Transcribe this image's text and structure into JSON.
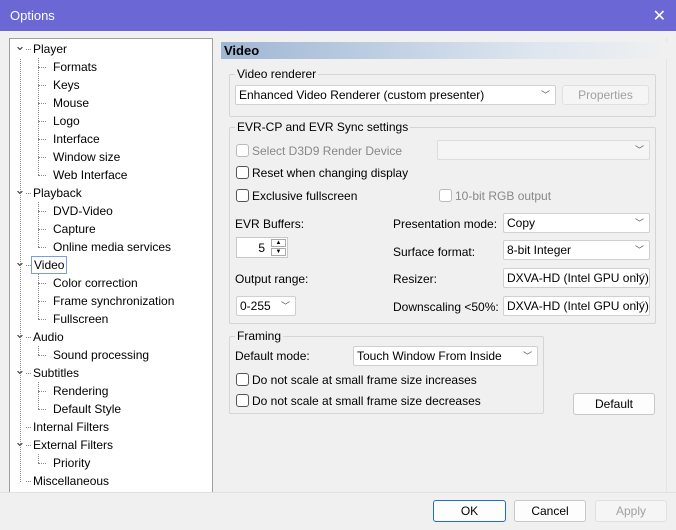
{
  "window": {
    "title": "Options",
    "close_icon": "close-icon",
    "title_color": "#6b68d5"
  },
  "tree": [
    {
      "label": "Player",
      "level": 0,
      "expanded": true
    },
    {
      "label": "Formats",
      "level": 1
    },
    {
      "label": "Keys",
      "level": 1
    },
    {
      "label": "Mouse",
      "level": 1
    },
    {
      "label": "Logo",
      "level": 1
    },
    {
      "label": "Interface",
      "level": 1
    },
    {
      "label": "Window size",
      "level": 1
    },
    {
      "label": "Web Interface",
      "level": 1
    },
    {
      "label": "Playback",
      "level": 0,
      "expanded": true
    },
    {
      "label": "DVD-Video",
      "level": 1
    },
    {
      "label": "Capture",
      "level": 1
    },
    {
      "label": "Online media services",
      "level": 1
    },
    {
      "label": "Video",
      "level": 0,
      "expanded": true,
      "selected": true
    },
    {
      "label": "Color correction",
      "level": 1
    },
    {
      "label": "Frame synchronization",
      "level": 1
    },
    {
      "label": "Fullscreen",
      "level": 1
    },
    {
      "label": "Audio",
      "level": 0,
      "expanded": true
    },
    {
      "label": "Sound processing",
      "level": 1
    },
    {
      "label": "Subtitles",
      "level": 0,
      "expanded": true
    },
    {
      "label": "Rendering",
      "level": 1
    },
    {
      "label": "Default Style",
      "level": 1
    },
    {
      "label": "Internal Filters",
      "level": 0
    },
    {
      "label": "External Filters",
      "level": 0,
      "expanded": true
    },
    {
      "label": "Priority",
      "level": 1
    },
    {
      "label": "Miscellaneous",
      "level": 0
    }
  ],
  "page": {
    "header": "Video",
    "renderer": {
      "group": "Video renderer",
      "value": "Enhanced Video Renderer (custom presenter)",
      "properties": "Properties"
    },
    "evr": {
      "group": "EVR-CP and EVR Sync settings",
      "select_d3d9": "Select D3D9 Render Device",
      "d3d9_value": "",
      "reset": "Reset when changing display",
      "exclusive": "Exclusive fullscreen",
      "rgb10": "10-bit RGB output",
      "buffers_label": "EVR Buffers:",
      "buffers_value": "5",
      "output_range_label": "Output range:",
      "output_range_value": "0-255",
      "presentation_label": "Presentation mode:",
      "presentation_value": "Copy",
      "surface_label": "Surface format:",
      "surface_value": "8-bit Integer",
      "resizer_label": "Resizer:",
      "resizer_value": "DXVA-HD (Intel GPU only)",
      "downscaling_label": "Downscaling <50%:",
      "downscaling_value": "DXVA-HD (Intel GPU only)"
    },
    "framing": {
      "group": "Framing",
      "default_mode_label": "Default mode:",
      "default_mode_value": "Touch Window From Inside",
      "no_scale_inc": "Do not scale at small frame size increases",
      "no_scale_dec": "Do not scale at small frame size decreases"
    },
    "default_button": "Default"
  },
  "footer": {
    "ok": "OK",
    "cancel": "Cancel",
    "apply": "Apply"
  }
}
